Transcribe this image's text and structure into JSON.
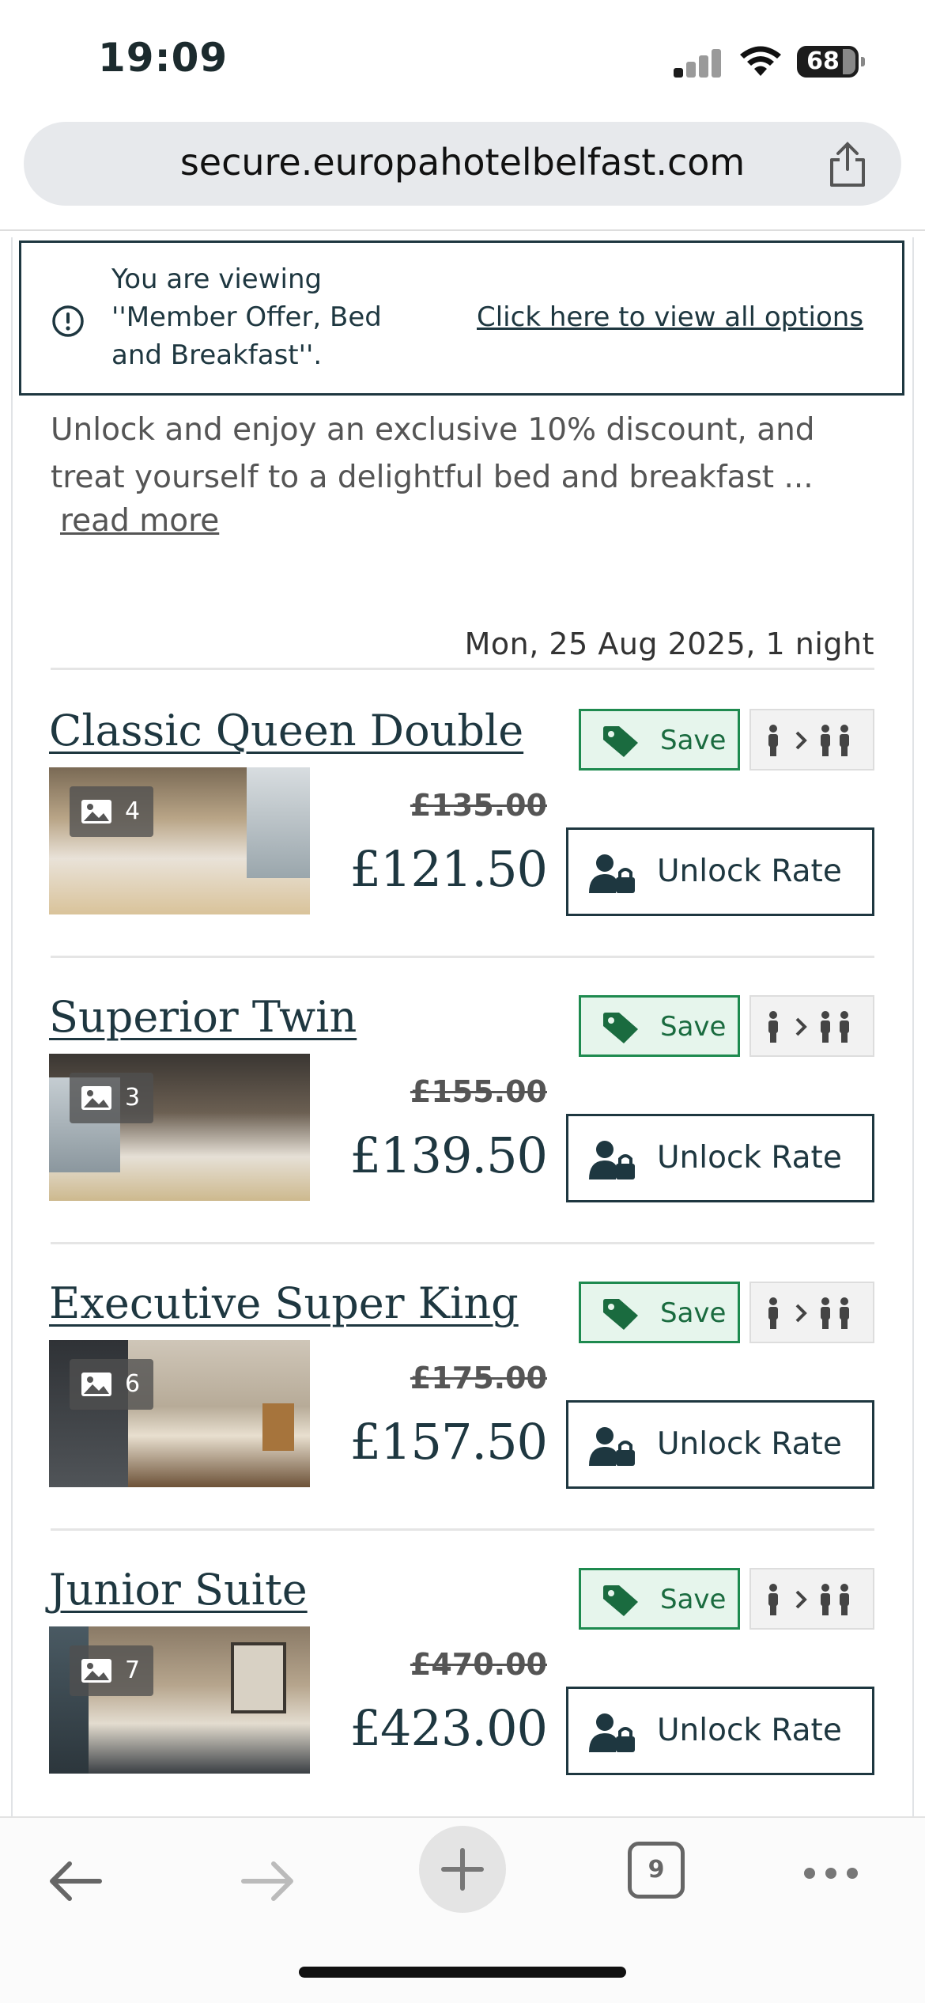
{
  "status_bar": {
    "time": "19:09",
    "battery": "68"
  },
  "browser": {
    "url": "secure.europahotelbelfast.com",
    "tab_count": "9"
  },
  "notice": {
    "message": "You are viewing ''Member Offer, Bed and Breakfast''.",
    "link": "Click here to view all options"
  },
  "offer": {
    "description": "Unlock and enjoy an exclusive 10% discount, and treat yourself to a delightful bed and breakfast ...",
    "read_more": "read more"
  },
  "stay": {
    "summary": "Mon, 25 Aug 2025, 1 night"
  },
  "labels": {
    "save": "Save",
    "unlock": "Unlock Rate"
  },
  "colors": {
    "accent": "#1e3740",
    "save_green": "#1e8a4f",
    "save_bg": "#e6f5ec"
  },
  "rooms": [
    {
      "name": "Classic Queen Double",
      "photos": "4",
      "was": "£135.00",
      "price": "£121.50"
    },
    {
      "name": "Superior Twin",
      "photos": "3",
      "was": "£155.00",
      "price": "£139.50"
    },
    {
      "name": "Executive Super King",
      "photos": "6",
      "was": "£175.00",
      "price": "£157.50"
    },
    {
      "name": "Junior Suite",
      "photos": "7",
      "was": "£470.00",
      "price": "£423.00"
    }
  ],
  "icons": [
    "info-icon",
    "share-icon",
    "image-icon",
    "tag-icon",
    "occupancy-icon",
    "member-lock-icon",
    "back-icon",
    "forward-icon",
    "plus-icon",
    "more-icon"
  ]
}
